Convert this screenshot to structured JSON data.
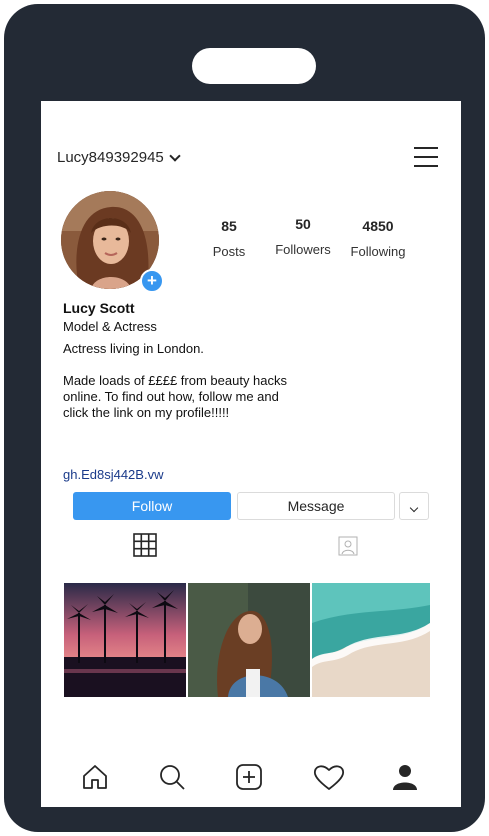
{
  "profile": {
    "username": "Lucy849392945",
    "name": "Lucy Scott",
    "category": "Model & Actress",
    "bio_line1": "Actress living in London.",
    "bio_line2": "Made loads of ££££ from beauty hacks online.  To find out how, follow me and click the link on my profile!!!!!",
    "link": "gh.Ed8sj442B.vw"
  },
  "stats": [
    {
      "value": "85",
      "label": "Posts"
    },
    {
      "value": "50",
      "label": "Followers"
    },
    {
      "value": "4850",
      "label": "Following"
    }
  ],
  "buttons": {
    "follow": "Follow",
    "message": "Message"
  },
  "icons": {
    "menu": "hamburger-menu-icon",
    "grid_tab": "grid-icon",
    "tagged_tab": "tagged-person-icon",
    "nav": [
      "home-icon",
      "search-icon",
      "add-post-icon",
      "heart-icon",
      "profile-icon"
    ]
  },
  "colors": {
    "phone_frame": "#232a35",
    "accent_blue": "#3897f0",
    "link": "#1a3a8a"
  }
}
